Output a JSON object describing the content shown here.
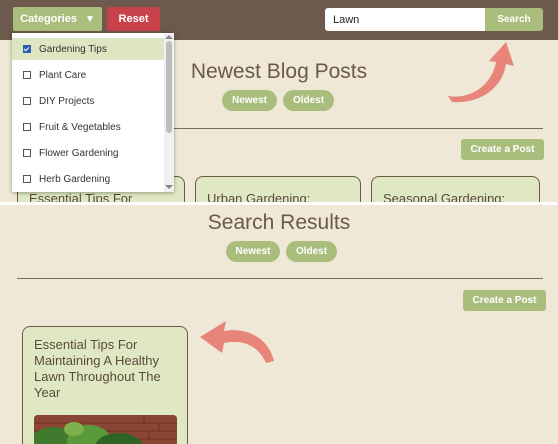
{
  "toolbar": {
    "categories_label": "Categories",
    "categories_caret": "▼",
    "reset_label": "Reset",
    "search_value": "Lawn",
    "search_button": "Search"
  },
  "categories_menu": [
    {
      "label": "Gardening Tips",
      "checked": true
    },
    {
      "label": "Plant Care",
      "checked": false
    },
    {
      "label": "DIY Projects",
      "checked": false
    },
    {
      "label": "Fruit & Vegetables",
      "checked": false
    },
    {
      "label": "Flower Gardening",
      "checked": false
    },
    {
      "label": "Herb Gardening",
      "checked": false
    }
  ],
  "blog": {
    "title": "Newest Blog Posts",
    "sort_newest": "Newest",
    "sort_oldest": "Oldest",
    "create_post": "Create a Post",
    "cards": [
      {
        "title": "Essential Tips For"
      },
      {
        "title": "Urban Gardening:"
      },
      {
        "title": "Seasonal Gardening:"
      }
    ]
  },
  "results": {
    "title": "Search Results",
    "sort_newest": "Newest",
    "sort_oldest": "Oldest",
    "create_post": "Create a Post",
    "card": {
      "title": "Essential Tips For Maintaining A Healthy Lawn Throughout The Year"
    }
  },
  "colors": {
    "topbar": "#6e5a4c",
    "background": "#efe8d6",
    "accent_green": "#a9bd7c",
    "reset_red": "#c7424a",
    "arrow": "#e8847a"
  }
}
